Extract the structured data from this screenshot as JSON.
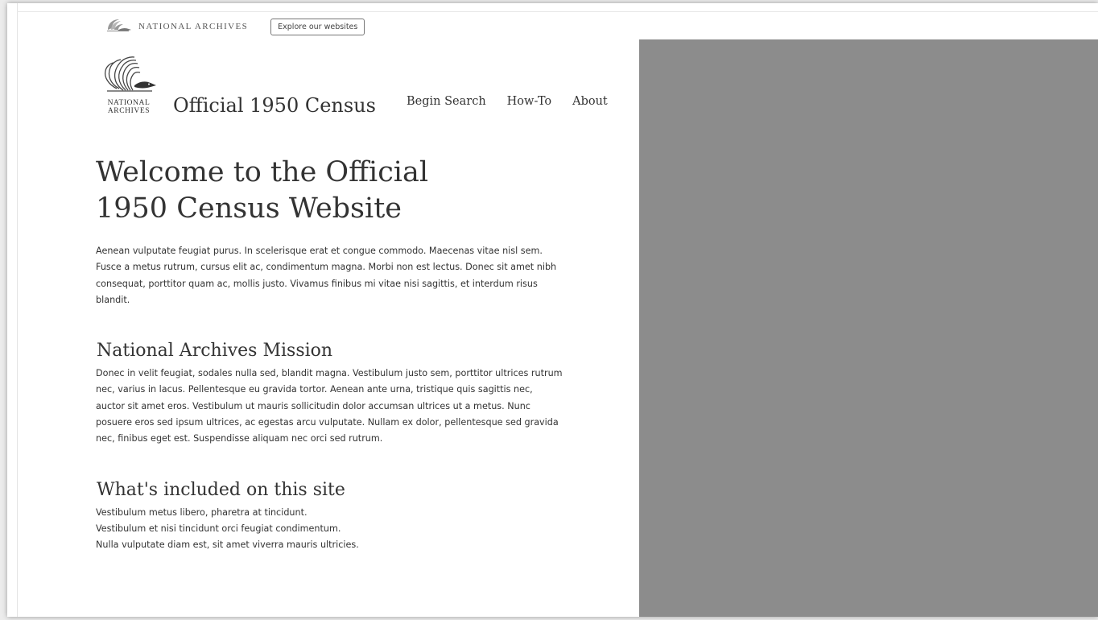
{
  "utility": {
    "org_name": "NATIONAL ARCHIVES",
    "explore_button": "Explore our websites"
  },
  "header": {
    "logo_text_line1": "NATIONAL",
    "logo_text_line2": "ARCHIVES",
    "site_title": "Official 1950 Census",
    "nav": [
      "Begin Search",
      "How-To",
      "About"
    ]
  },
  "main": {
    "title_line1": "Welcome to the Official",
    "title_line2": "1950 Census Website",
    "intro": "Aenean vulputate feugiat purus. In scelerisque erat et congue commodo. Maecenas vitae nisl sem. Fusce a metus rutrum, cursus elit ac, condimentum magna. Morbi non est lectus. Donec sit amet nibh consequat, porttitor quam ac, mollis justo. Vivamus finibus mi vitae nisi sagittis, et interdum risus blandit.",
    "mission_heading": "National Archives Mission",
    "mission_text": "Donec in velit feugiat, sodales nulla sed, blandit magna. Vestibulum justo sem, porttitor ultrices rutrum nec, varius in lacus. Pellentesque eu gravida tortor. Aenean ante urna, tristique quis sagittis nec, auctor sit amet eros. Vestibulum ut mauris sollicitudin dolor accumsan ultrices ut a metus. Nunc posuere eros sed ipsum ultrices, ac egestas arcu vulputate. Nullam ex dolor, pellentesque sed gravida nec, finibus eget est. Suspendisse aliquam nec orci sed rutrum.",
    "included_heading": "What's included on this site",
    "included_items": [
      "Vestibulum metus libero, pharetra at tincidunt.",
      "Vestibulum et nisi tincidunt orci feugiat condimentum.",
      "Nulla vulputate diam est, sit amet viverra mauris ultricies."
    ]
  },
  "colors": {
    "image_placeholder": "#8c8c8c",
    "text": "#333333"
  },
  "icons": {
    "utility_logo": "eagle-logo-icon",
    "brand_logo": "eagle-logo-icon"
  }
}
